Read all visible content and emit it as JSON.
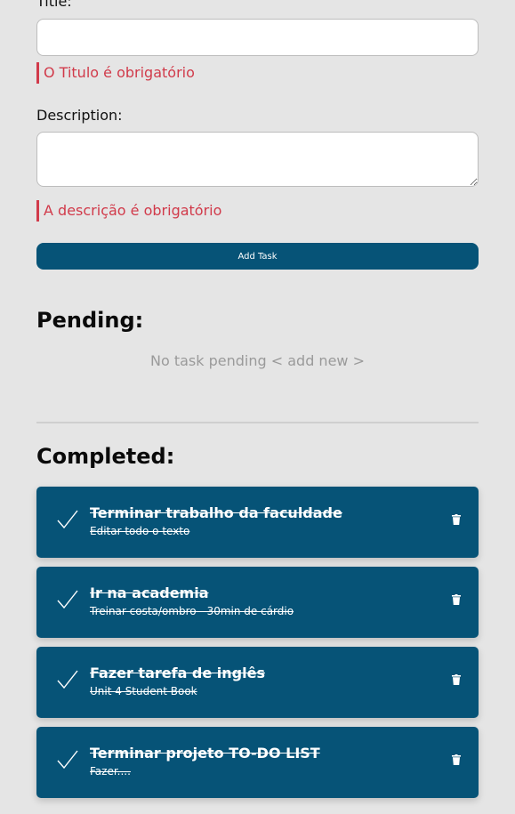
{
  "form": {
    "title_label": "Title:",
    "title_value": "",
    "title_error": "O Titulo é obrigatório",
    "description_label": "Description:",
    "description_value": "",
    "description_error": "A descrição é obrigatório",
    "add_button_label": "Add Task"
  },
  "pending": {
    "heading": "Pending:",
    "empty_message": "No task pending < add new >"
  },
  "completed": {
    "heading": "Completed:",
    "tasks": [
      {
        "title": "Terminar trabalho da faculdade",
        "description": "Editar todo o texto"
      },
      {
        "title": "Ir na academia",
        "description": "Treinar costa/ombro - 30min de cárdio"
      },
      {
        "title": "Fazer tarefa de inglês",
        "description": "Unit 4 Student Book"
      },
      {
        "title": "Terminar projeto TO-DO LIST",
        "description": "Fazer...."
      }
    ]
  },
  "icons": {
    "check": "check-icon",
    "trash": "trash-icon"
  },
  "colors": {
    "background": "#e5e5e5",
    "primary": "#065377",
    "error": "#d13a4a",
    "muted": "#9a9a9a"
  }
}
